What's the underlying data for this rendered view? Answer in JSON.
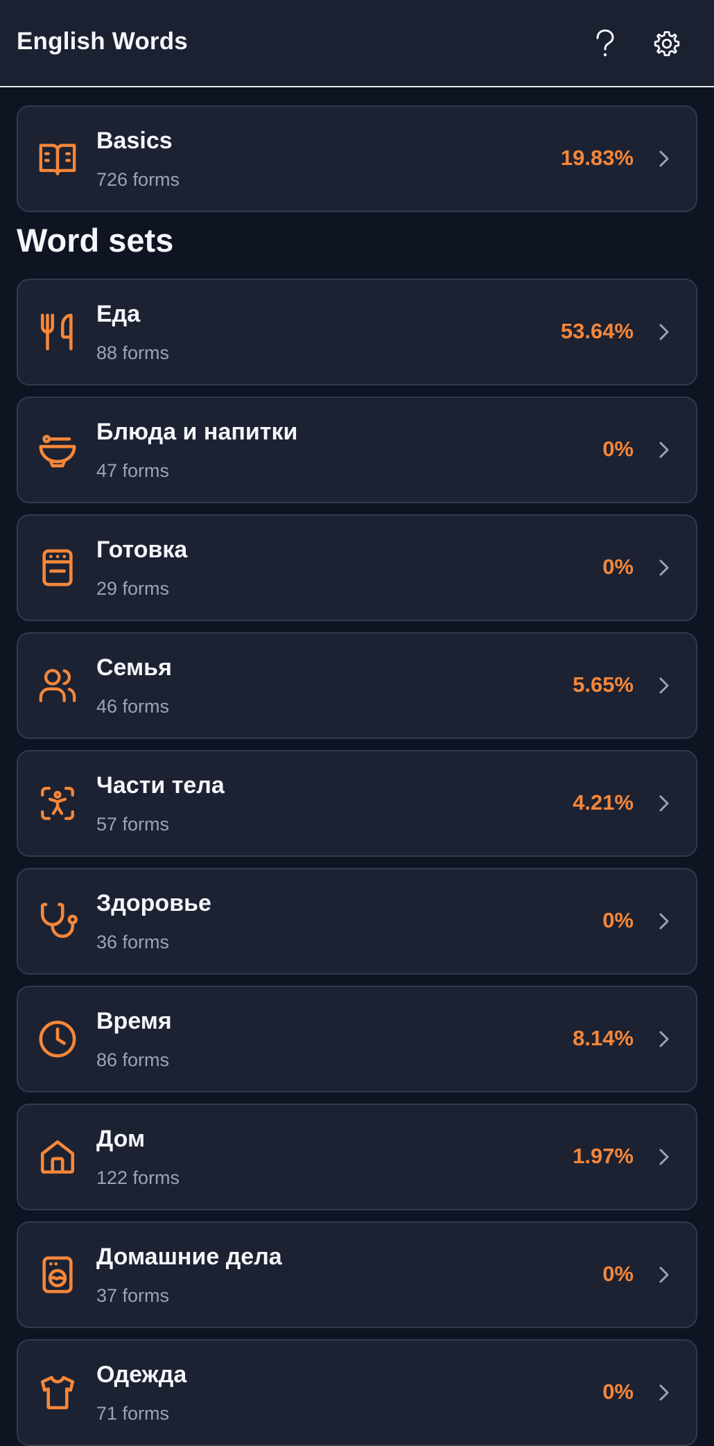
{
  "header": {
    "title": "English Words",
    "help_icon": "help-icon",
    "settings_icon": "gear-icon"
  },
  "basics": {
    "title": "Basics",
    "subtitle": "726 forms",
    "percent": "19.83%",
    "icon": "book-icon"
  },
  "section": {
    "title": "Word sets"
  },
  "word_sets": [
    {
      "title": "Еда",
      "subtitle": "88 forms",
      "percent": "53.64%",
      "icon": "utensils-icon"
    },
    {
      "title": "Блюда и напитки",
      "subtitle": "47 forms",
      "percent": "0%",
      "icon": "bowl-icon"
    },
    {
      "title": "Готовка",
      "subtitle": "29 forms",
      "percent": "0%",
      "icon": "stove-icon"
    },
    {
      "title": "Семья",
      "subtitle": "46 forms",
      "percent": "5.65%",
      "icon": "users-icon"
    },
    {
      "title": "Части тела",
      "subtitle": "57 forms",
      "percent": "4.21%",
      "icon": "body-scan-icon"
    },
    {
      "title": "Здоровье",
      "subtitle": "36 forms",
      "percent": "0%",
      "icon": "stethoscope-icon"
    },
    {
      "title": "Время",
      "subtitle": "86 forms",
      "percent": "8.14%",
      "icon": "clock-icon"
    },
    {
      "title": "Дом",
      "subtitle": "122 forms",
      "percent": "1.97%",
      "icon": "house-icon"
    },
    {
      "title": "Домашние дела",
      "subtitle": "37 forms",
      "percent": "0%",
      "icon": "washing-machine-icon"
    },
    {
      "title": "Одежда",
      "subtitle": "71 forms",
      "percent": "0%",
      "icon": "shirt-icon"
    }
  ],
  "colors": {
    "accent": "#f6873a",
    "background": "#0e1422",
    "card": "#1c2232",
    "muted_text": "#9ca4b4"
  }
}
